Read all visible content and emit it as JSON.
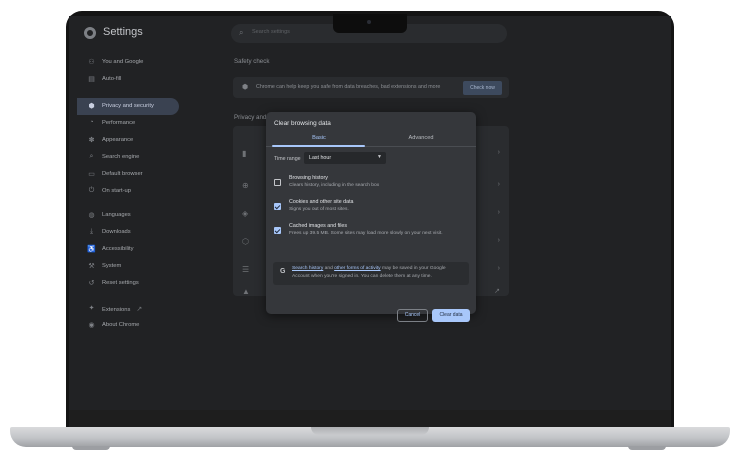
{
  "app": {
    "title": "Settings"
  },
  "search": {
    "placeholder": "Search settings"
  },
  "sidebar": {
    "items": [
      {
        "label": "You and Google",
        "icon": "person-icon"
      },
      {
        "label": "Auto-fill",
        "icon": "autofill-icon"
      },
      {
        "label": "Privacy and security",
        "icon": "shield-icon",
        "active": true
      },
      {
        "label": "Performance",
        "icon": "speedometer-icon"
      },
      {
        "label": "Appearance",
        "icon": "palette-icon"
      },
      {
        "label": "Search engine",
        "icon": "search-icon"
      },
      {
        "label": "Default browser",
        "icon": "browser-icon"
      },
      {
        "label": "On start-up",
        "icon": "power-icon"
      },
      {
        "label": "Languages",
        "icon": "globe-icon"
      },
      {
        "label": "Downloads",
        "icon": "download-icon"
      },
      {
        "label": "Accessibility",
        "icon": "accessibility-icon"
      },
      {
        "label": "System",
        "icon": "wrench-icon"
      },
      {
        "label": "Reset settings",
        "icon": "reset-icon"
      },
      {
        "label": "Extensions",
        "icon": "puzzle-icon"
      },
      {
        "label": "About Chrome",
        "icon": "chrome-icon"
      }
    ]
  },
  "safety_check": {
    "heading": "Safety check",
    "text": "Chrome can help keep you safe from data breaches, bad extensions and more",
    "button": "Check now"
  },
  "privacy": {
    "heading": "Privacy and s"
  },
  "dialog": {
    "title": "Clear browsing data",
    "tabs": [
      "Basic",
      "Advanced"
    ],
    "active_tab": "Basic",
    "time_range_label": "Time range",
    "time_range_value": "Last hour",
    "options": [
      {
        "title": "Browsing history",
        "subtitle": "Clears history, including in the search box",
        "checked": false
      },
      {
        "title": "Cookies and other site data",
        "subtitle": "Signs you out of most sites.",
        "checked": true
      },
      {
        "title": "Cached images and files",
        "subtitle": "Frees up 39.5 MB. Some sites may load more slowly on your next visit.",
        "checked": true
      }
    ],
    "google_note": {
      "link1": "Search history",
      "and": " and ",
      "link2": "other forms of activity",
      "rest1": " may be saved in your Google",
      "line2": "Account when you're signed in. You can delete them at any time."
    },
    "cancel": "Cancel",
    "clear": "Clear data"
  },
  "colors": {
    "accent": "#a8c7fa",
    "dialog_bg": "#35373b",
    "screen_bg": "#212224"
  }
}
